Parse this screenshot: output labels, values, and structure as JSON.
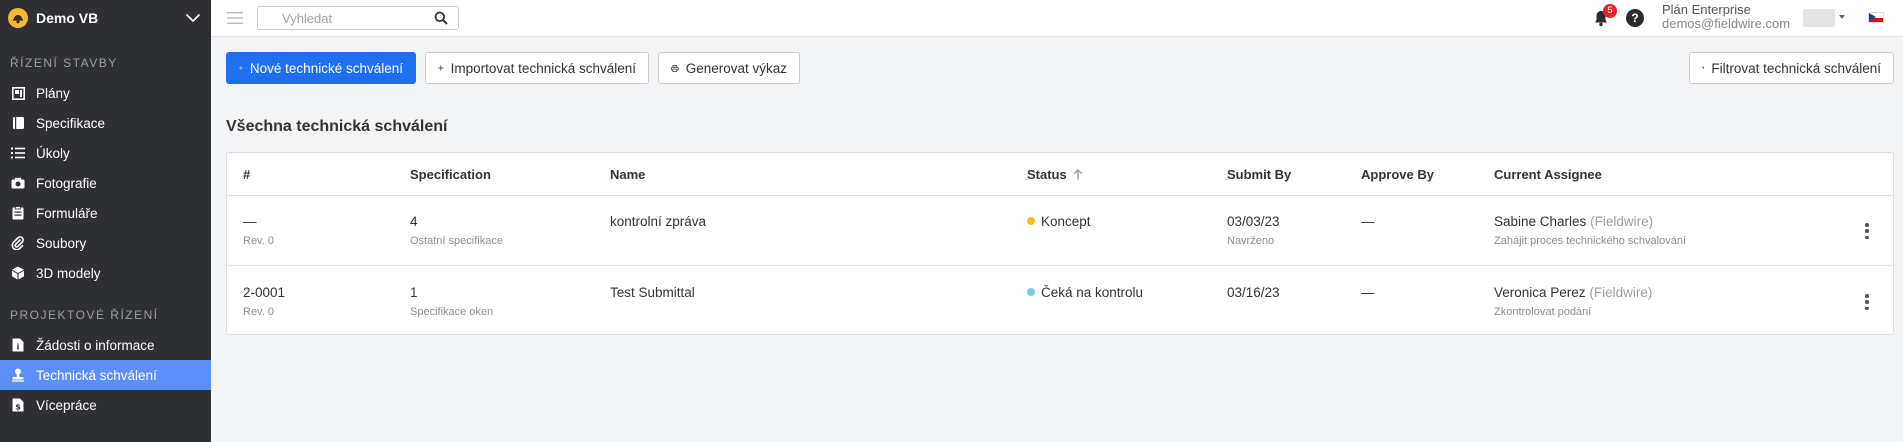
{
  "sidebar": {
    "project_name": "Demo VB",
    "sections": [
      {
        "title": "Řízení stavby",
        "items": [
          {
            "label": "Plány",
            "icon": "plans-icon"
          },
          {
            "label": "Specifikace",
            "icon": "specifications-icon"
          },
          {
            "label": "Úkoly",
            "icon": "tasks-icon"
          },
          {
            "label": "Fotografie",
            "icon": "camera-icon"
          },
          {
            "label": "Formuláře",
            "icon": "clipboard-icon"
          },
          {
            "label": "Soubory",
            "icon": "paperclip-icon"
          },
          {
            "label": "3D modely",
            "icon": "cube-icon"
          }
        ]
      },
      {
        "title": "Projektové řízení",
        "items": [
          {
            "label": "Žádosti o informace",
            "icon": "rfi-icon"
          },
          {
            "label": "Technická schválení",
            "icon": "stamp-icon",
            "active": true
          },
          {
            "label": "Vícepráce",
            "icon": "change-order-icon"
          }
        ]
      }
    ]
  },
  "topbar": {
    "search_placeholder": "Vyhledat",
    "notification_count": "5",
    "help_label": "?",
    "plan_name": "Plán Enterprise",
    "user_email": "demos@fieldwire.com"
  },
  "toolbar": {
    "new_label": "Nové technické schválení",
    "import_label": "Importovat technická schválení",
    "report_label": "Generovat výkaz",
    "filter_label": "Filtrovat technická schválení"
  },
  "page_title": "Všechna technická schválení",
  "table": {
    "columns": [
      "#",
      "Specification",
      "Name",
      "Status",
      "Submit By",
      "Approve By",
      "Current Assignee"
    ],
    "rows": [
      {
        "number": "—",
        "revision": "Rev. 0",
        "spec_number": "4",
        "spec_name": "Ostatní specifikace",
        "name": "kontrolní zpráva",
        "status": "Koncept",
        "status_color": "#f2c01e",
        "submit_by": "03/03/23",
        "submit_by_note": "Navrženo",
        "approve_by": "—",
        "assignee": "Sabine Charles",
        "assignee_org": "(Fieldwire)",
        "assignee_task": "Zahájit proces technického schvalování"
      },
      {
        "number": "2-0001",
        "revision": "Rev. 0",
        "spec_number": "1",
        "spec_name": "Specifikace oken",
        "name": "Test Submittal",
        "status": "Čeká na kontrolu",
        "status_color": "#7cc8ee",
        "submit_by": "03/16/23",
        "submit_by_note": "",
        "approve_by": "—",
        "assignee": "Veronica Perez",
        "assignee_org": "(Fieldwire)",
        "assignee_task": "Zkontrolovat podání"
      }
    ]
  },
  "colors": {
    "primary": "#1f6ff0",
    "sidebar_bg": "#2f3033",
    "sidebar_active": "#5c8ff7",
    "overdue": "#e0222b"
  }
}
